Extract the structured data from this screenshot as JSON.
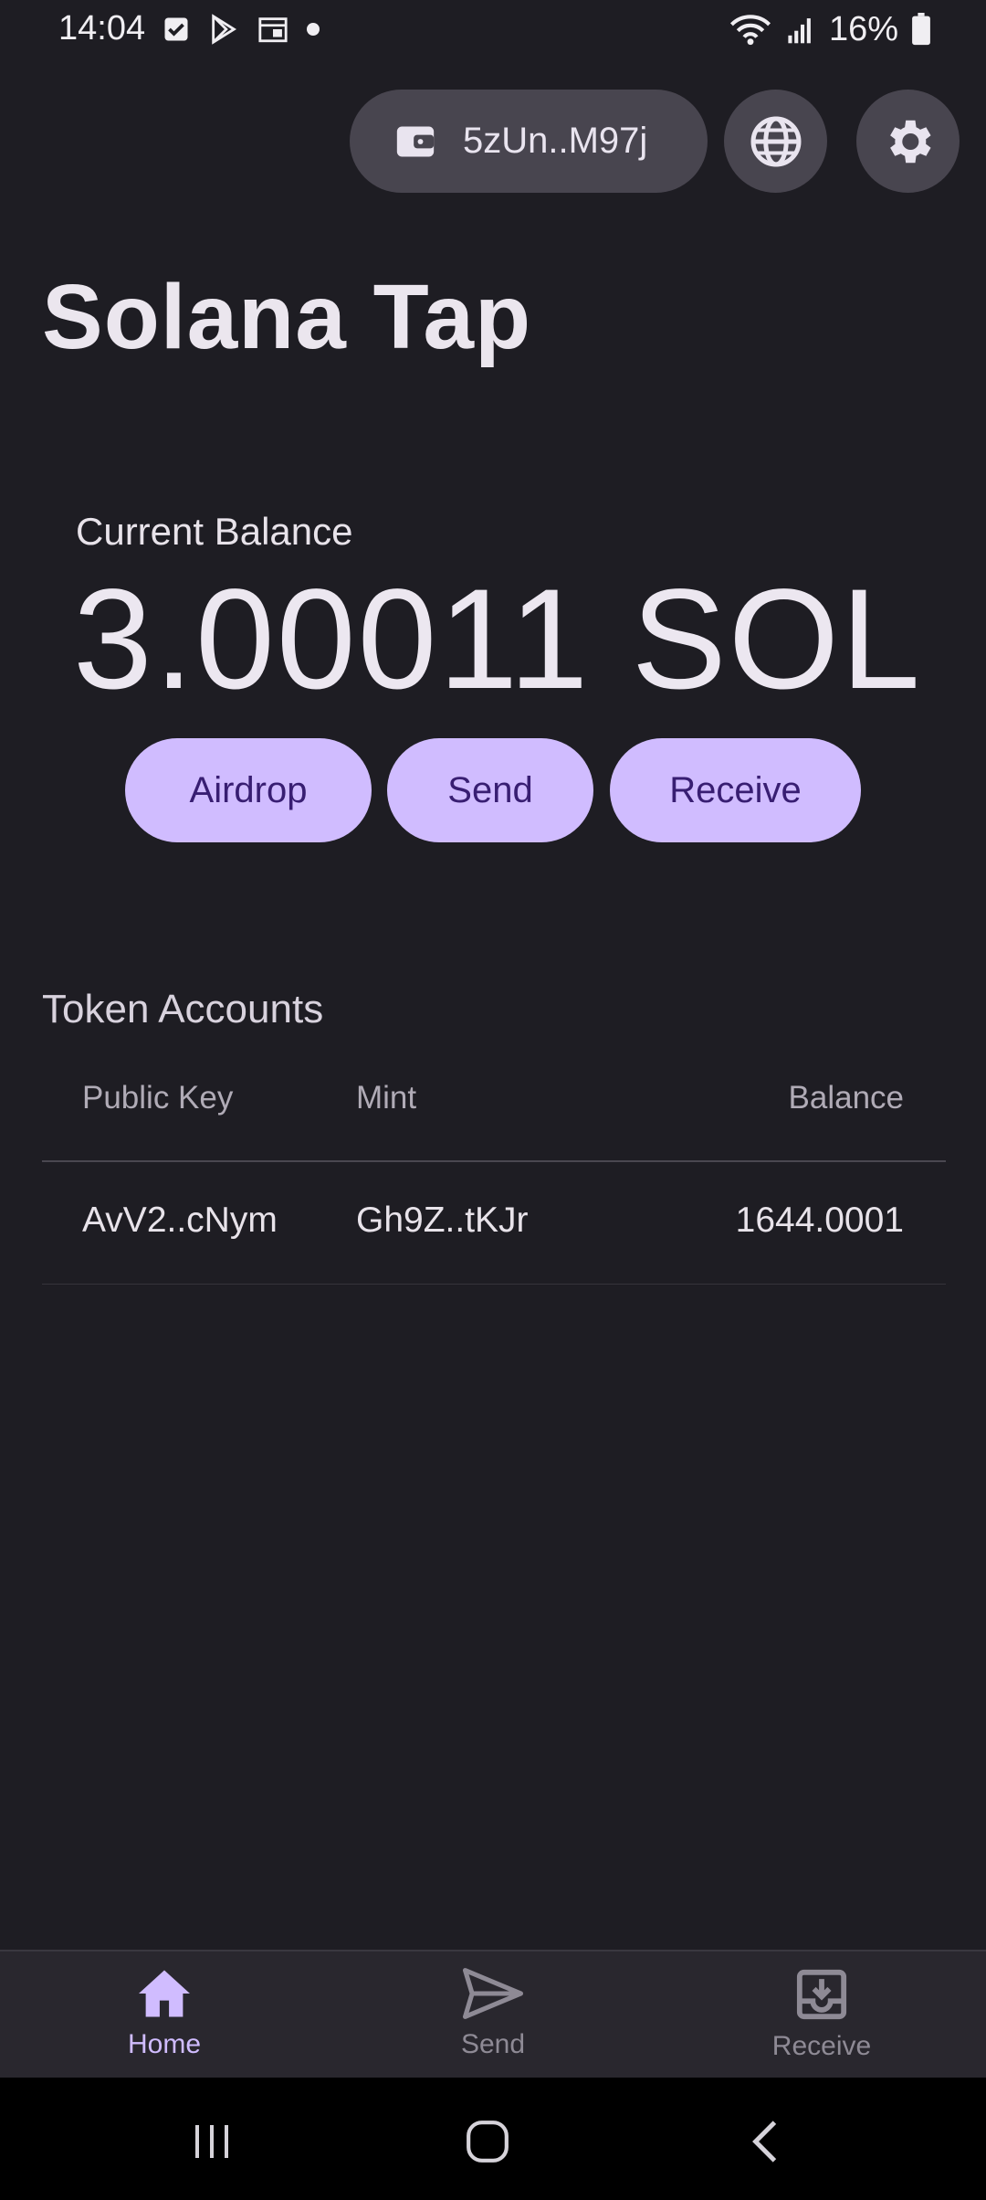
{
  "status_bar": {
    "time": "14:04",
    "battery": "16%",
    "left_icons": [
      "checkbox-icon",
      "play-store-icon",
      "calendar-icon",
      "dot-icon"
    ],
    "right_icons": [
      "wifi-icon",
      "signal-icon",
      "battery-icon"
    ]
  },
  "header": {
    "wallet_address": "5zUn..M97j",
    "icons": [
      "wallet-icon",
      "globe-icon",
      "gear-icon"
    ]
  },
  "app_title": "Solana Tap",
  "balance": {
    "label": "Current Balance",
    "value": "3.00011 SOL"
  },
  "actions": {
    "airdrop": "Airdrop",
    "send": "Send",
    "receive": "Receive"
  },
  "token_accounts": {
    "title": "Token Accounts",
    "columns": [
      "Public Key",
      "Mint",
      "Balance"
    ],
    "rows": [
      {
        "public_key": "AvV2..cNym",
        "mint": "Gh9Z..tKJr",
        "balance": "1644.0001"
      }
    ]
  },
  "bottom_nav": {
    "items": [
      {
        "label": "Home",
        "icon": "home-icon",
        "active": true
      },
      {
        "label": "Send",
        "icon": "send-icon",
        "active": false
      },
      {
        "label": "Receive",
        "icon": "download-icon",
        "active": false
      }
    ]
  },
  "colors": {
    "background": "#1e1d23",
    "accent": "#d0bcff",
    "accent_text": "#381e72",
    "chip": "#48454f"
  }
}
